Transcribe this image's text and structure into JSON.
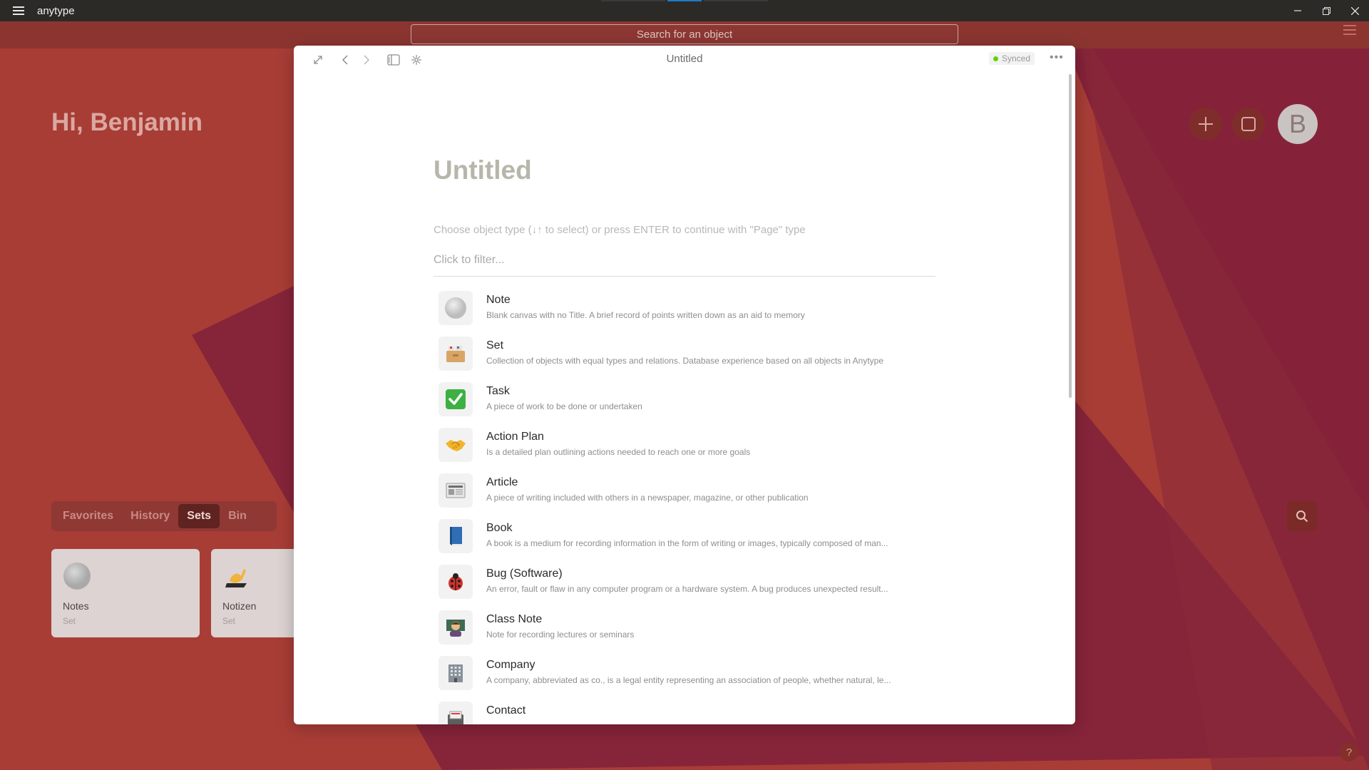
{
  "app": {
    "name": "anytype"
  },
  "search": {
    "placeholder": "Search for an object"
  },
  "dashboard": {
    "greeting": "Hi, Benjamin",
    "avatar_initial": "B",
    "tabs": [
      {
        "label": "Favorites",
        "active": false
      },
      {
        "label": "History",
        "active": false
      },
      {
        "label": "Sets",
        "active": true
      },
      {
        "label": "Bin",
        "active": false
      }
    ],
    "cards": [
      {
        "title": "Notes",
        "type": "Set",
        "icon": "grey-circle-icon"
      },
      {
        "title": "Notizen",
        "type": "Set",
        "icon": "writing-hand-icon"
      }
    ]
  },
  "modal": {
    "header_title": "Untitled",
    "sync_status": "Synced",
    "page_title": "Untitled",
    "hint": "Choose object type (↓↑ to select) or press ENTER to continue with \"Page\" type",
    "filter_placeholder": "Click to filter...",
    "types": [
      {
        "name": "Note",
        "icon": "grey-circle-icon",
        "description": "Blank canvas with no Title. A brief record of points written down as an aid to memory"
      },
      {
        "name": "Set",
        "icon": "card-file-box-icon",
        "description": "Collection of objects with equal types and relations. Database experience based on all objects in Anytype"
      },
      {
        "name": "Task",
        "icon": "check-mark-icon",
        "description": "A piece of work to be done or undertaken"
      },
      {
        "name": "Action Plan",
        "icon": "handshake-icon",
        "description": "Is a detailed plan outlining actions needed to reach one or more goals"
      },
      {
        "name": "Article",
        "icon": "newspaper-icon",
        "description": "A piece of writing included with others in a newspaper, magazine, or other publication"
      },
      {
        "name": "Book",
        "icon": "blue-book-icon",
        "description": "A book is a medium for recording information in the form of writing or images, typically composed of man..."
      },
      {
        "name": "Bug (Software)",
        "icon": "ladybug-icon",
        "description": "An error, fault or flaw in any computer program or a hardware system. A bug produces unexpected result..."
      },
      {
        "name": "Class Note",
        "icon": "teacher-icon",
        "description": "Note for recording lectures or seminars"
      },
      {
        "name": "Company",
        "icon": "office-building-icon",
        "description": "A company, abbreviated as co., is a legal entity representing an association of people, whether natural, le..."
      },
      {
        "name": "Contact",
        "icon": "address-book-icon",
        "description": ""
      }
    ]
  },
  "colors": {
    "background": "#a83d36",
    "accent_dark": "#7e2d2b",
    "sync_dot": "#5dd400"
  }
}
